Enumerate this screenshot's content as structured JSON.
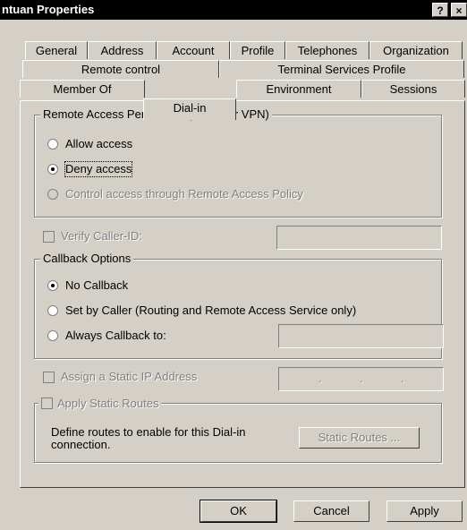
{
  "window": {
    "title": "ntuan Properties",
    "help_label": "?",
    "close_label": "×"
  },
  "tabs": {
    "row1": [
      "General",
      "Address",
      "Account",
      "Profile",
      "Telephones",
      "Organization"
    ],
    "row2": [
      "Remote control",
      "Terminal Services Profile"
    ],
    "row3": [
      "Member Of",
      "Dial-in",
      "Environment",
      "Sessions"
    ],
    "active": "Dial-in"
  },
  "remote_access": {
    "legend": "Remote Access Permission (Dial-in or VPN)",
    "allow": "Allow access",
    "deny": "Deny access",
    "policy": "Control access through Remote Access Policy",
    "selected": "deny"
  },
  "verify_caller_id": {
    "label": "Verify Caller-ID:",
    "value": ""
  },
  "callback": {
    "legend": "Callback Options",
    "no_callback": "No Callback",
    "set_by_caller": "Set by Caller (Routing and Remote Access Service only)",
    "always": "Always Callback to:",
    "always_value": "",
    "selected": "no_callback"
  },
  "static_ip": {
    "label": "Assign a Static IP Address",
    "dot1": ".",
    "dot2": ".",
    "dot3": "."
  },
  "static_routes": {
    "label": "Apply Static Routes",
    "description": "Define routes to enable for this Dial-in connection.",
    "button": "Static Routes ..."
  },
  "buttons": {
    "ok": "OK",
    "cancel": "Cancel",
    "apply": "Apply"
  }
}
